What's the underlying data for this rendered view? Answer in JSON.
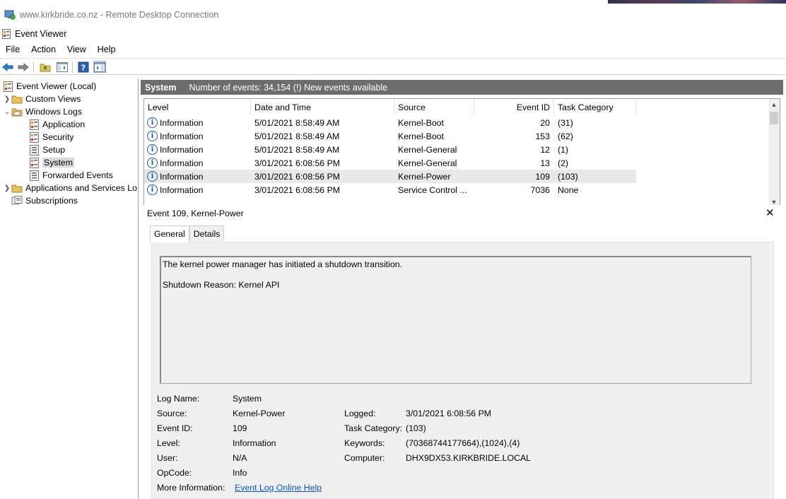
{
  "rdp": {
    "title": "www.kirkbride.co.nz - Remote Desktop Connection"
  },
  "window": {
    "title": "Event Viewer"
  },
  "menu": [
    "File",
    "Action",
    "View",
    "Help"
  ],
  "toolbar": {
    "buttons": [
      "back-icon",
      "forward-icon",
      "folder-up-icon",
      "show-hide-tree-icon",
      "help-icon",
      "show-hide-action-pane-icon"
    ]
  },
  "tree": {
    "root": "Event Viewer (Local)",
    "custom_views": "Custom Views",
    "windows_logs": "Windows Logs",
    "logs": [
      "Application",
      "Security",
      "Setup",
      "System",
      "Forwarded Events"
    ],
    "apps_services": "Applications and Services Lo",
    "subscriptions": "Subscriptions"
  },
  "header": {
    "log_name": "System",
    "info": "Number of events: 34,154 (!) New events available"
  },
  "grid": {
    "columns": [
      "Level",
      "Date and Time",
      "Source",
      "Event ID",
      "Task Category"
    ],
    "rows": [
      {
        "level": "Information",
        "datetime": "5/01/2021 8:58:49 AM",
        "source": "Kernel-Boot",
        "event_id": "20",
        "task": "(31)"
      },
      {
        "level": "Information",
        "datetime": "5/01/2021 8:58:49 AM",
        "source": "Kernel-Boot",
        "event_id": "153",
        "task": "(62)"
      },
      {
        "level": "Information",
        "datetime": "5/01/2021 8:58:49 AM",
        "source": "Kernel-General",
        "event_id": "12",
        "task": "(1)"
      },
      {
        "level": "Information",
        "datetime": "3/01/2021 6:08:56 PM",
        "source": "Kernel-General",
        "event_id": "13",
        "task": "(2)"
      },
      {
        "level": "Information",
        "datetime": "3/01/2021 6:08:56 PM",
        "source": "Kernel-Power",
        "event_id": "109",
        "task": "(103)"
      },
      {
        "level": "Information",
        "datetime": "3/01/2021 6:08:56 PM",
        "source": "Service Control ...",
        "event_id": "7036",
        "task": "None"
      }
    ]
  },
  "detail": {
    "title": "Event 109, Kernel-Power",
    "tabs": [
      "General",
      "Details"
    ],
    "description_line1": "The kernel power manager has initiated a shutdown transition.",
    "description_line2": "Shutdown Reason: Kernel API",
    "labels": {
      "log_name": "Log Name:",
      "source": "Source:",
      "event_id": "Event ID:",
      "level": "Level:",
      "user": "User:",
      "opcode": "OpCode:",
      "more_info": "More Information:",
      "logged": "Logged:",
      "task_category": "Task Category:",
      "keywords": "Keywords:",
      "computer": "Computer:"
    },
    "values": {
      "log_name": "System",
      "source": "Kernel-Power",
      "event_id": "109",
      "level": "Information",
      "user": "N/A",
      "opcode": "Info",
      "more_info": "Event Log Online Help",
      "logged": "3/01/2021 6:08:56 PM",
      "task_category": "(103)",
      "keywords": "(70368744177664),(1024),(4)",
      "computer": "DHX9DX53.KIRKBRIDE.LOCAL"
    }
  },
  "colors": {
    "header_bg": "#6d6d6d",
    "link": "#0b52c4",
    "info_icon": "#1c5aa6"
  }
}
